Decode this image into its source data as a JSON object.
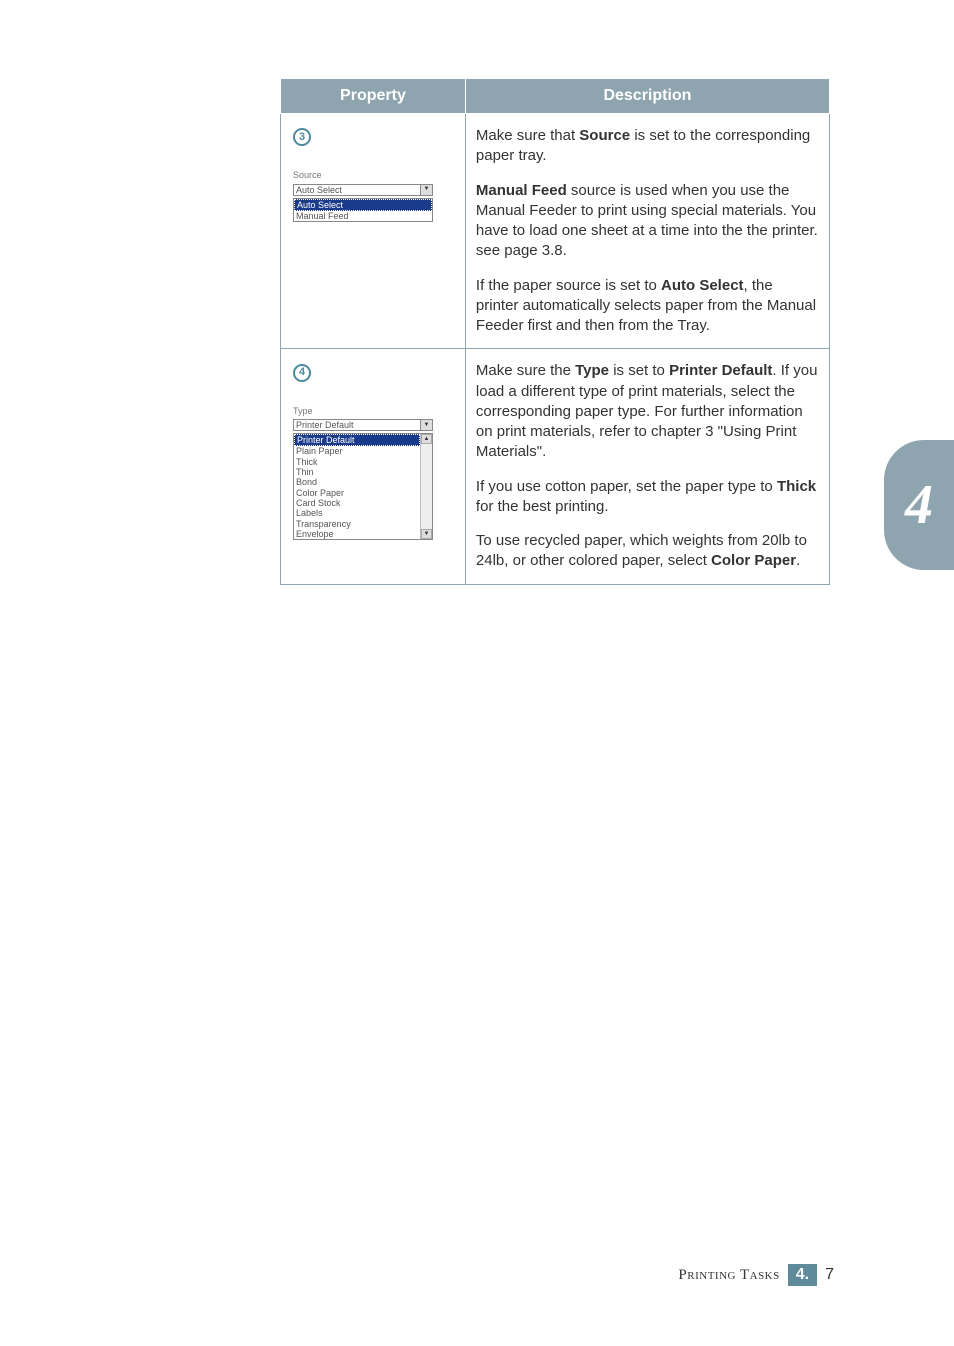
{
  "side_tab": {
    "number": "4"
  },
  "table": {
    "headers": {
      "property": "Property",
      "description": "Description"
    },
    "rows": [
      {
        "badge": "3",
        "ui": {
          "label": "Source",
          "combo_value": "Auto Select",
          "list_items": [
            "Auto Select",
            "Manual Feed"
          ],
          "selected_index": 0
        },
        "paragraphs": [
          {
            "pre": "Make sure that ",
            "b1": "Source",
            "post": " is set to the corresponding paper tray."
          },
          {
            "b1": "Manual Feed",
            "post": " source is used when you use the Manual Feeder to print using special materials. You have to load one sheet at a time into the the printer. see page 3.8."
          },
          {
            "pre": "If the paper source is set to ",
            "b1": "Auto Select",
            "post": ", the printer automatically selects paper from the Manual Feeder first and then from the Tray."
          }
        ]
      },
      {
        "badge": "4",
        "ui": {
          "label": "Type",
          "combo_value": "Printer Default",
          "list_items": [
            "Printer Default",
            "Plain Paper",
            "Thick",
            "Thin",
            "Bond",
            "Color Paper",
            "Card Stock",
            "Labels",
            "Transparency",
            "Envelope"
          ],
          "selected_index": 0
        },
        "paragraphs": [
          {
            "pre": "Make sure the ",
            "b1": "Type",
            "mid1": " is set to ",
            "b2": "Printer Default",
            "post": ". If you load a different type of print materials, select the corresponding paper type. For further information on print materials, refer to chapter 3 \"Using Print Materials\"."
          },
          {
            "pre": "If you use cotton paper, set the paper type to ",
            "b1": "Thick",
            "post": " for the best printing."
          },
          {
            "pre": "To use recycled paper, which weights from 20lb to 24lb, or other colored paper, select ",
            "b1": "Color Paper",
            "post": "."
          }
        ]
      }
    ]
  },
  "footer": {
    "title": "Printing Tasks",
    "section": "4.",
    "page": "7"
  }
}
